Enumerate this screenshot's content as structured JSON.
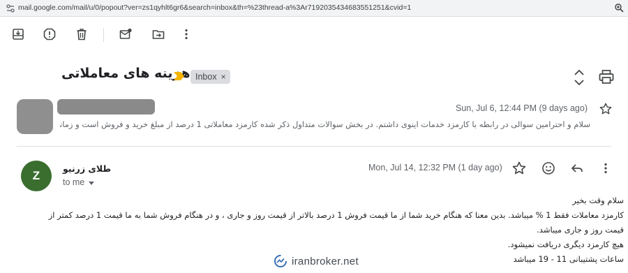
{
  "browser": {
    "url": "mail.google.com/mail/u/0/popout?ver=zs1qyhlt6gr6&search=inbox&th=%23thread-a%3Ar7192035434683551251&cvid=1",
    "icons": {
      "lock": "tune-icon",
      "zoom": "zoom-icon"
    }
  },
  "toolbar": {
    "buttons": [
      "archive",
      "report-spam",
      "delete",
      "mark-unread",
      "move-to",
      "more"
    ]
  },
  "thread": {
    "subject": "هزینه های معاملاتی",
    "label": "Inbox",
    "label_close": "×"
  },
  "message1": {
    "date": "Sun, Jul 6, 12:44 PM (9 days ago)",
    "snippet": "سلام و احترامین سوالی در رابطه با کارمزد خدمات اینوی داشتم. در بخش سوالات متداول ذکر شده کارمزد معاملاتی 1 درصد از مبلغ خرید و فروش است و زمانی که به قیم ..."
  },
  "message2": {
    "avatar_letter": "Z",
    "avatar_color": "#3a6e2f",
    "sender": "طلای زرنیو",
    "to": "to me",
    "date": "Mon, Jul 14, 12:32 PM (1 day ago)",
    "body": [
      "سلام وقت بخیر",
      "کارمزد معاملات فقط 1 % میباشد. بدین معنا که هنگام خرید شما از ما قیمت فروش 1 درصد بالاتر از قیمت روز و جاری ، و در هنگام فروش شما به ما  قیمت 1 درصد کمتر از",
      "قیمت روز و جاری میباشد.",
      "هیچ کارمزد دیگری دریافت نمیشود.",
      "ساعات پشتیبانی 11 - 19 میباشد"
    ]
  },
  "watermark": {
    "text": "iranbroker.net",
    "color": "#3b6fb6"
  },
  "colors": {
    "importance": "#f4b400",
    "chip_bg": "#dadce0"
  }
}
